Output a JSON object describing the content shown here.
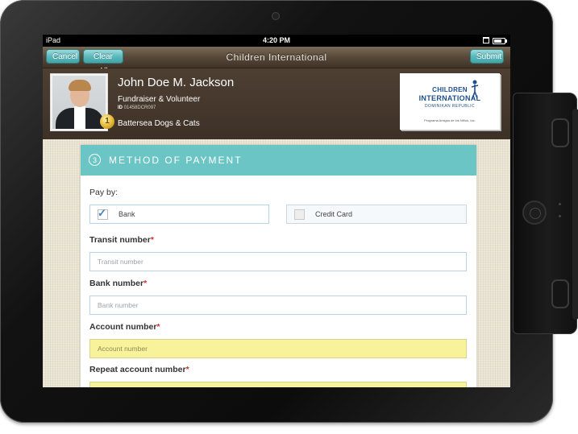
{
  "status_bar": {
    "device": "iPad",
    "time": "4:20 PM"
  },
  "nav": {
    "cancel": "Cancel",
    "clear_all": "Clear All",
    "title": "Children International",
    "submit": "Submit"
  },
  "profile": {
    "name": "John Doe M. Jackson",
    "role": "Fundraiser & Volunteer",
    "id_label": "ID",
    "id_value": "01458DCR097",
    "medal": "1",
    "organization": "Battersea Dogs & Cats"
  },
  "logo": {
    "line1": "CHILDREN",
    "line2": "INTERNATIONAL",
    "line3": "DOMINIKAN REPUBLIC",
    "tagline": "Programa Amigos de los Niños, Inc."
  },
  "payment": {
    "step": "3",
    "title": "METHOD OF PAYMENT",
    "pay_by": "Pay by:",
    "options": [
      {
        "label": "Bank",
        "checked": true
      },
      {
        "label": "Credit Card",
        "checked": false
      }
    ],
    "fields": [
      {
        "label": "Transit number",
        "required": "*",
        "placeholder": "Transit number",
        "highlight": false
      },
      {
        "label": "Bank number",
        "required": "*",
        "placeholder": "Bank number",
        "highlight": false
      },
      {
        "label": "Account number",
        "required": "*",
        "placeholder": "Account number",
        "highlight": true
      },
      {
        "label": "Repeat account number",
        "required": "*",
        "placeholder": "",
        "highlight": true
      }
    ]
  },
  "colors": {
    "accent": "#6cc5c5",
    "highlight_field": "#f8f29b",
    "required": "#d0312d"
  }
}
